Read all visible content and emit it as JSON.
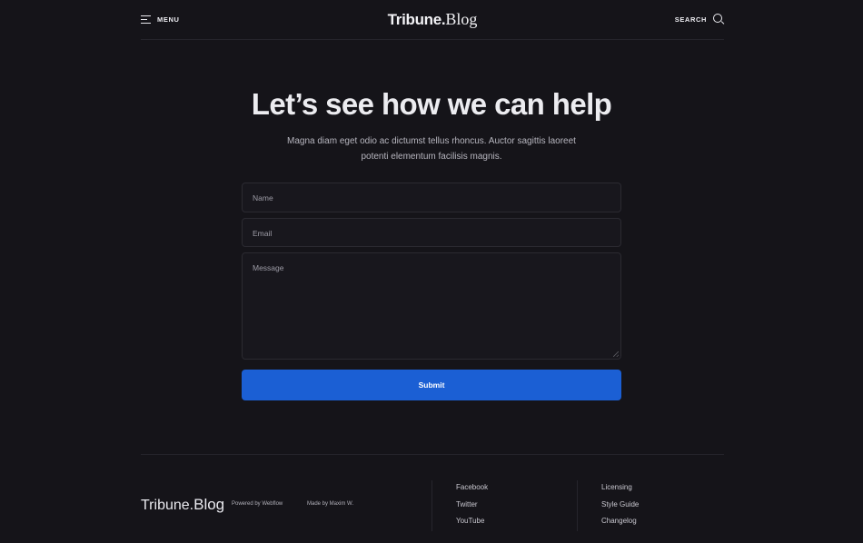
{
  "header": {
    "menu_label": "MENU",
    "logo_bold": "Tribune.",
    "logo_serif": "Blog",
    "search_label": "SEARCH"
  },
  "hero": {
    "title": "Let’s see how we can help",
    "subtitle": "Magna diam eget odio ac dictumst tellus rhoncus. Auctor sagittis laoreet potenti elementum facilisis magnis."
  },
  "form": {
    "name_placeholder": "Name",
    "email_placeholder": "Email",
    "message_placeholder": "Message",
    "submit_label": "Submit"
  },
  "footer": {
    "logo_bold": "Tribune.",
    "logo_serif": "Blog",
    "powered_by": "Powered by Webflow",
    "made_by": "Made by Maxim W.",
    "social_links": [
      "Facebook",
      "Twitter",
      "YouTube"
    ],
    "info_links": [
      "Licensing",
      "Style Guide",
      "Changelog"
    ]
  },
  "colors": {
    "background": "#151419",
    "accent": "#1b5fd4",
    "field_background": "#18171d"
  }
}
